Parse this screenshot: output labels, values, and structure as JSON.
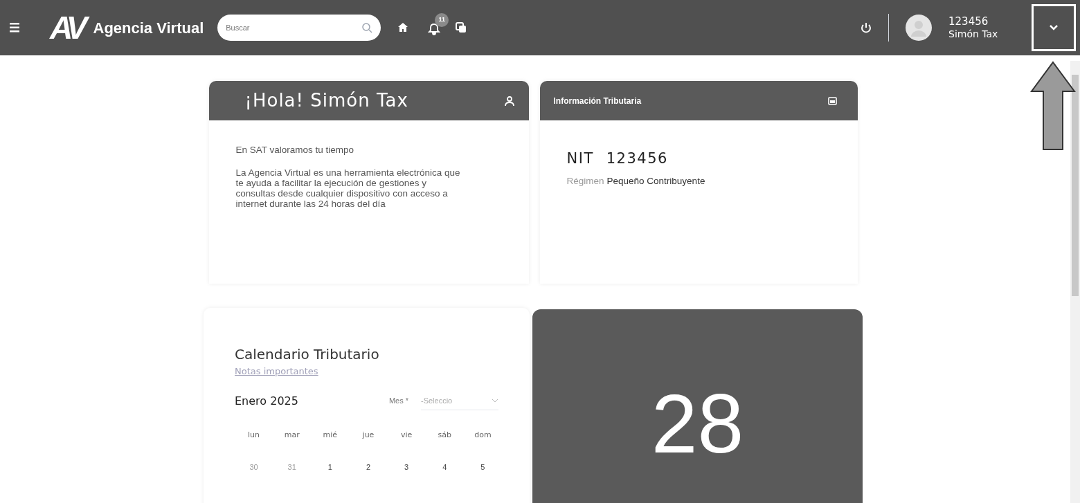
{
  "top_bar": {
    "logo": "AV",
    "app_name": "Agencia Virtual",
    "search": {
      "placeholder": "Buscar"
    },
    "notifications_badge": "11",
    "user": {
      "id": "123456",
      "name": "Simón Tax"
    }
  },
  "greeting_card": {
    "title": "¡Hola! Simón Tax",
    "tagline": "En SAT valoramos tu tiempo",
    "description": "La Agencia Virtual es una herramienta electrónica que te ayuda a facilitar la ejecución de gestiones y consultas desde cualquier dispositivo con acceso a internet durante las 24 horas del día"
  },
  "tax_info_card": {
    "title": "Información Tributaria",
    "nit_label": "NIT",
    "nit": "123456",
    "regime_label": "Régimen",
    "regime": "Pequeño Contribuyente"
  },
  "calendar": {
    "title": "Calendario Tributario",
    "notes_link": "Notas importantes",
    "month": "Enero 2025",
    "month_field": {
      "label": "Mes *",
      "placeholder": "-Seleccio"
    },
    "weekdays": [
      "lun",
      "mar",
      "mié",
      "jue",
      "vie",
      "sáb",
      "dom"
    ],
    "days": [
      {
        "label": "30",
        "outside": true
      },
      {
        "label": "31",
        "outside": true
      },
      {
        "label": "1",
        "outside": false
      },
      {
        "label": "2",
        "outside": false
      },
      {
        "label": "3",
        "outside": false
      },
      {
        "label": "4",
        "outside": false
      },
      {
        "label": "5",
        "outside": false
      }
    ]
  },
  "today_card": {
    "day": "28"
  }
}
